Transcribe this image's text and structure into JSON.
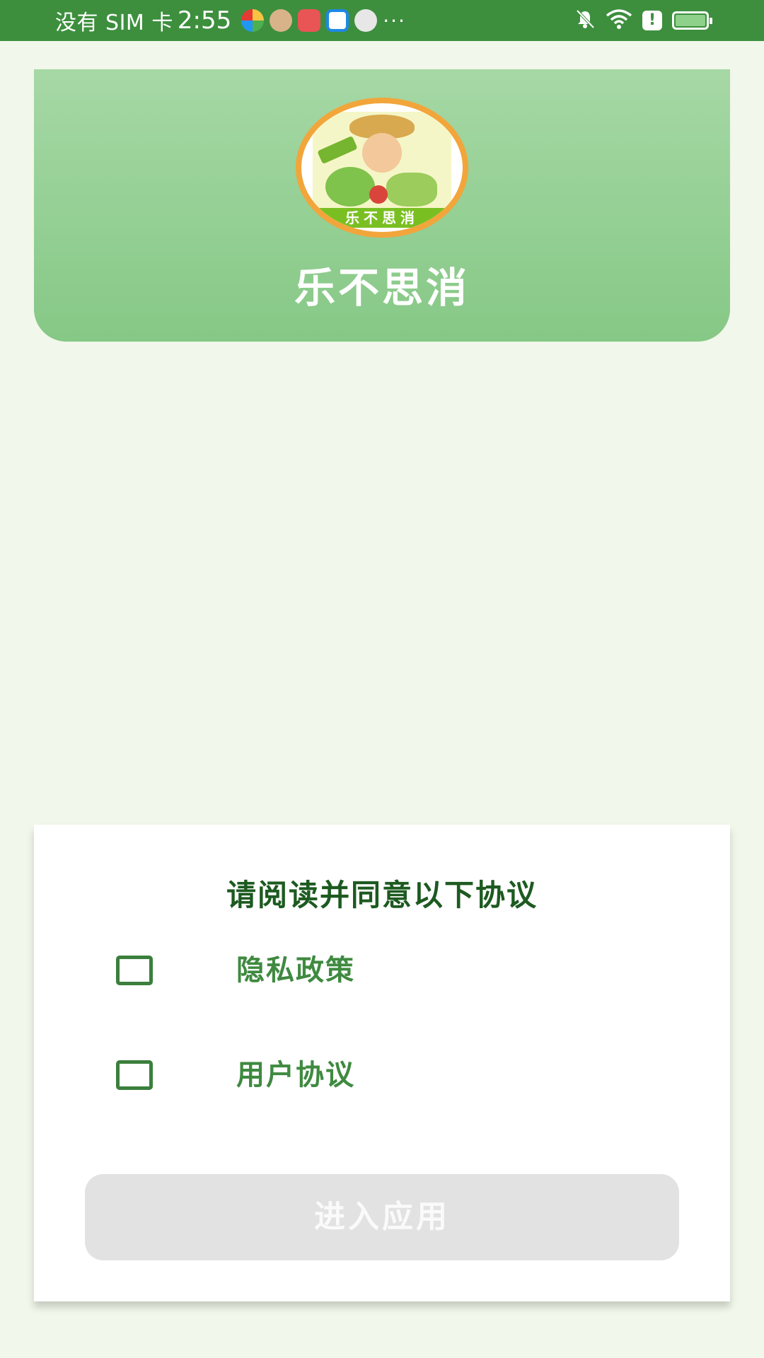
{
  "status_bar": {
    "carrier": "没有 SIM 卡",
    "time": "2:55",
    "more": "···",
    "notification_icons": [
      "color-wheel-icon",
      "avatar-icon",
      "huawei-app-icon",
      "blue-app-icon",
      "avatar-icon"
    ],
    "system_icons": [
      "bell-muted-icon",
      "wifi-icon",
      "alert-icon",
      "battery-charging-icon"
    ]
  },
  "header": {
    "logo_text": "乐不思消",
    "app_title": "乐不思消"
  },
  "agreement": {
    "heading": "请阅读并同意以下协议",
    "items": [
      {
        "label": "隐私政策",
        "checked": false
      },
      {
        "label": "用户协议",
        "checked": false
      }
    ],
    "enter_button": "进入应用",
    "enter_enabled": false
  },
  "colors": {
    "status_bar": "#3d8f3e",
    "background": "#f1f7ea",
    "header_gradient_top": "#a6d8a5",
    "header_gradient_bottom": "#86c886",
    "heading": "#1d5a20",
    "label": "#3f8a40",
    "button_disabled": "#e2e2e2"
  }
}
